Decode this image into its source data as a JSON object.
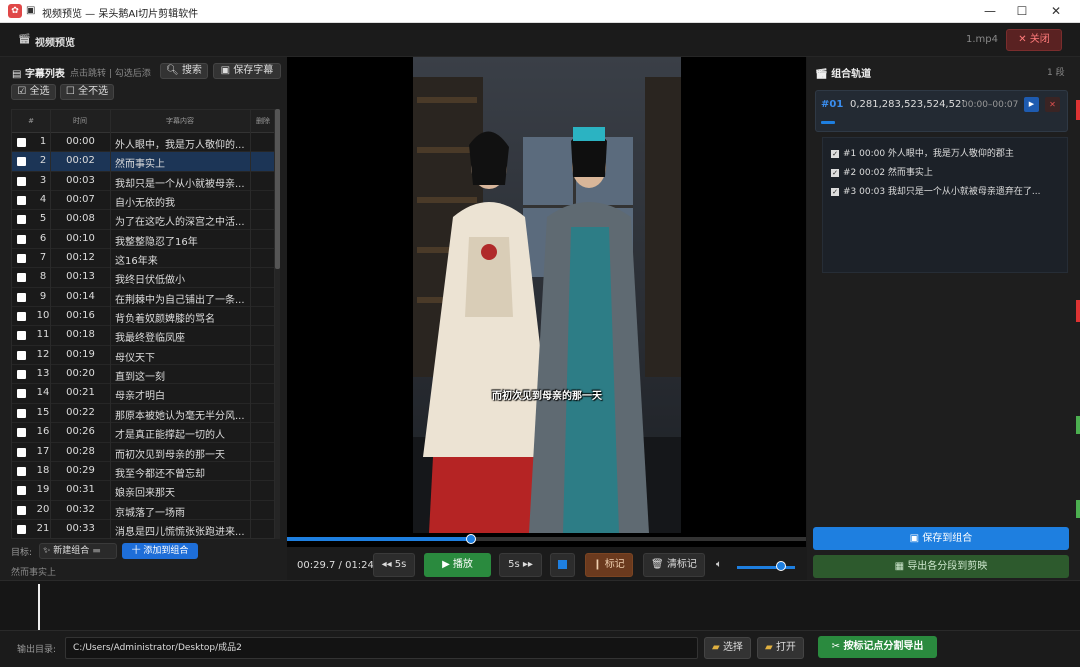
{
  "window": {
    "title": "视频预览 — 呆头鹅AI切片剪辑软件",
    "minimize": "—",
    "maximize": "☐",
    "close": "✕"
  },
  "header": {
    "title": "视频预览",
    "filename": "1.mp4",
    "close_label": "✕ 关闭"
  },
  "subtitle_list": {
    "title": "字幕列表",
    "hint": "点击跳转 | 勾选后添",
    "search_label": "搜索",
    "save_label": "保存字幕",
    "select_all": "☑ 全选",
    "select_none": "☐ 全不选",
    "columns": [
      "#",
      "时间",
      "字幕内容",
      "删除"
    ],
    "rows": [
      {
        "num": "1",
        "time": "00:00",
        "text": "外人眼中，我是万人敬仰的..."
      },
      {
        "num": "2",
        "time": "00:02",
        "text": "然而事实上"
      },
      {
        "num": "3",
        "time": "00:03",
        "text": "我却只是一个从小就被母亲..."
      },
      {
        "num": "4",
        "time": "00:07",
        "text": "自小无依的我"
      },
      {
        "num": "5",
        "time": "00:08",
        "text": "为了在这吃人的深宫之中活..."
      },
      {
        "num": "6",
        "time": "00:10",
        "text": "我整整隐忍了16年"
      },
      {
        "num": "7",
        "time": "00:12",
        "text": "这16年来"
      },
      {
        "num": "8",
        "time": "00:13",
        "text": "我终日伏低做小"
      },
      {
        "num": "9",
        "time": "00:14",
        "text": "在荆棘中为自己铺出了一条..."
      },
      {
        "num": "10",
        "time": "00:16",
        "text": "背负着奴颜婢膝的骂名"
      },
      {
        "num": "11",
        "time": "00:18",
        "text": "我最终登临凤座"
      },
      {
        "num": "12",
        "time": "00:19",
        "text": "母仪天下"
      },
      {
        "num": "13",
        "time": "00:20",
        "text": "直到这一刻"
      },
      {
        "num": "14",
        "time": "00:21",
        "text": "母亲才明白"
      },
      {
        "num": "15",
        "time": "00:22",
        "text": "那原本被她认为毫无半分风..."
      },
      {
        "num": "16",
        "time": "00:26",
        "text": "才是真正能撑起一切的人"
      },
      {
        "num": "17",
        "time": "00:28",
        "text": "而初次见到母亲的那一天"
      },
      {
        "num": "18",
        "time": "00:29",
        "text": "我至今都还不曾忘却"
      },
      {
        "num": "19",
        "time": "00:31",
        "text": "娘亲回来那天"
      },
      {
        "num": "20",
        "time": "00:32",
        "text": "京城落了一场雨"
      },
      {
        "num": "21",
        "time": "00:33",
        "text": "消息是四儿慌慌张张跑进来..."
      }
    ],
    "selected_row": 2,
    "target_label": "目标:",
    "new_combo": "新建组合",
    "add_combo": "十 添加到组合",
    "current_text": "然而事实上"
  },
  "player": {
    "caption": "而初次见到母亲的那一天",
    "time": "00:29.7 / 01:24",
    "progress": 0.354,
    "back_label": "◂◂ 5s",
    "play_label": "▶ 播放",
    "fwd_label": "5s ▸▸",
    "mark_label": "标记",
    "clear_label": "清标记",
    "volume": 0.75
  },
  "combo": {
    "title": "组合轨道",
    "count": "1 段",
    "id": "#01",
    "nums": "0,281,283,523,524,527",
    "range": "00:00–00:07",
    "items": [
      "#1  00:00  外人眼中，我是万人敬仰的郡主",
      "#2  00:02  然而事实上",
      "#3  00:03  我却只是一个从小就被母亲遗弃在了..."
    ],
    "save_label": "保存到组合",
    "export_label": "导出各分段到剪映"
  },
  "output": {
    "label": "输出目录:",
    "path": "C:/Users/Administrator/Desktop/成品2",
    "choose": "选择",
    "open": "打开",
    "export": "按标记点分割导出"
  },
  "colors": {
    "accent": "#1e7fe0",
    "danger": "#d33",
    "success": "#2a8a3e"
  }
}
